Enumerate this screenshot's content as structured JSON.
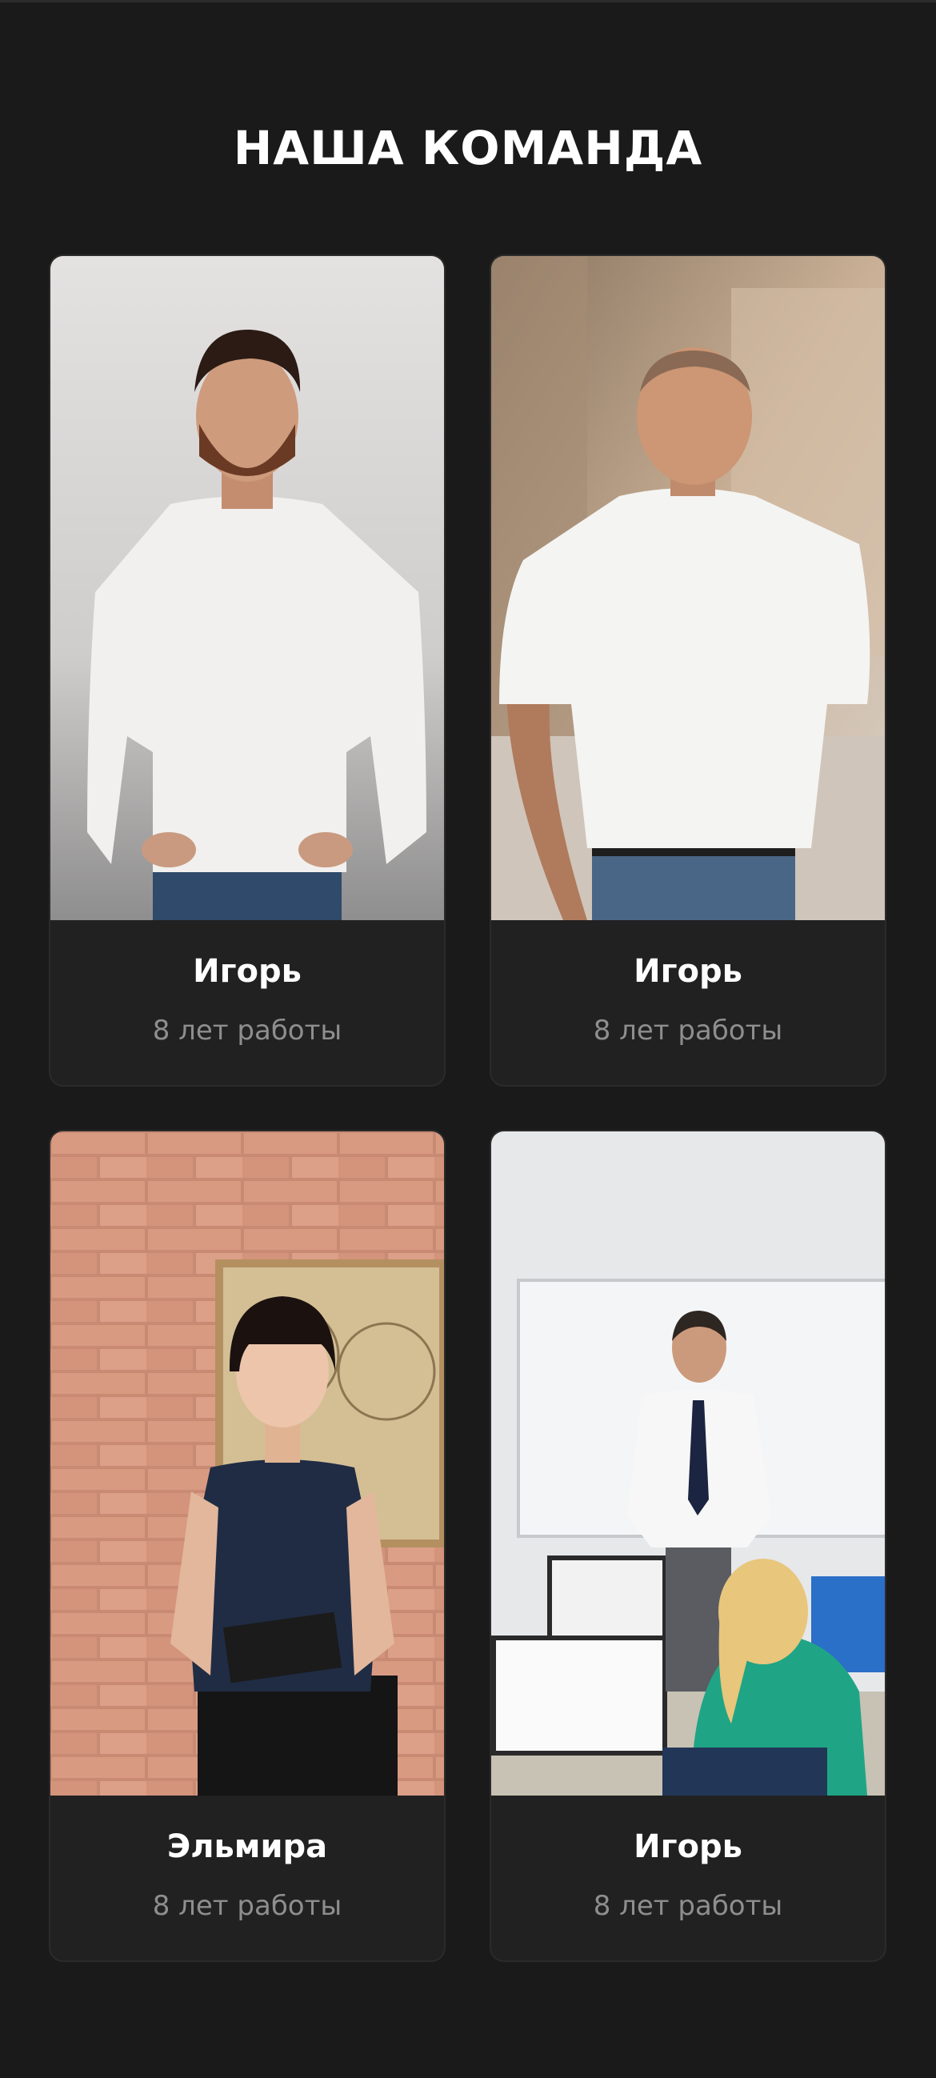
{
  "section": {
    "title": "НАША КОМАНДА"
  },
  "team": [
    {
      "name": "Игорь",
      "experience": "8 лет работы",
      "photo": "man-white-sweater-photo"
    },
    {
      "name": "Игорь",
      "experience": "8 лет работы",
      "photo": "man-white-shirt-warehouse-photo"
    },
    {
      "name": "Эльмира",
      "experience": "8 лет работы",
      "photo": "woman-brick-wall-photo"
    },
    {
      "name": "Игорь",
      "experience": "8 лет работы",
      "photo": "man-office-classroom-photo"
    }
  ],
  "colors": {
    "background": "#1a1a1a",
    "card": "#212121",
    "title": "#ffffff",
    "muted": "#8e8e8e"
  }
}
